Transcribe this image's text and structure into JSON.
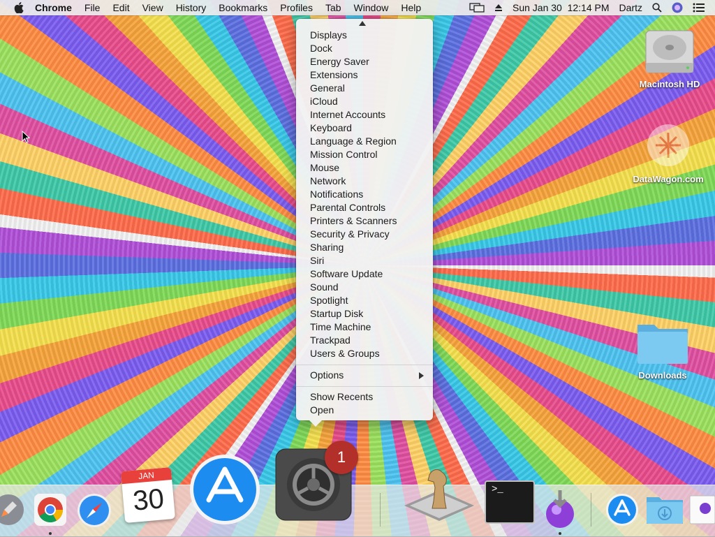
{
  "menubar": {
    "app_name": "Chrome",
    "menus": [
      "File",
      "Edit",
      "View",
      "History",
      "Bookmarks",
      "Profiles",
      "Tab",
      "Window",
      "Help"
    ],
    "clock": "Sun Jan 30  12:14 PM",
    "user": "Dartz",
    "icons": [
      "apple-icon",
      "display-mirroring-icon",
      "eject-icon",
      "search-icon",
      "user-avatar-icon",
      "notification-center-icon"
    ]
  },
  "desktop": {
    "icons": [
      {
        "label": "Macintosh HD",
        "icon": "hard-drive-icon"
      },
      {
        "label": "DataWagon.com",
        "icon": "server-file-icon"
      },
      {
        "label": "Downloads",
        "icon": "folder-icon"
      }
    ]
  },
  "menu": {
    "items": [
      "Displays",
      "Dock",
      "Energy Saver",
      "Extensions",
      "General",
      "iCloud",
      "Internet Accounts",
      "Keyboard",
      "Language & Region",
      "Mission Control",
      "Mouse",
      "Network",
      "Notifications",
      "Parental Controls",
      "Printers & Scanners",
      "Security & Privacy",
      "Sharing",
      "Siri",
      "Software Update",
      "Sound",
      "Spotlight",
      "Startup Disk",
      "Time Machine",
      "Trackpad",
      "Users & Groups"
    ],
    "options_label": "Options",
    "show_recents_label": "Show Recents",
    "open_label": "Open"
  },
  "dock": {
    "apps": [
      "Launchpad",
      "Google Chrome",
      "Safari",
      "Calendar",
      "App Store",
      "System Preferences",
      "Chess",
      "Terminal",
      "Installer",
      "App Store",
      "Downloads",
      "Document"
    ],
    "calendar_month": "JAN",
    "calendar_day": "30",
    "badge_count": "1",
    "terminal_prompt": ">_"
  },
  "colors": {
    "menu_background": "#f2f2f2",
    "badge": "#b3302a",
    "folder_blue": "#6cc4f0"
  }
}
